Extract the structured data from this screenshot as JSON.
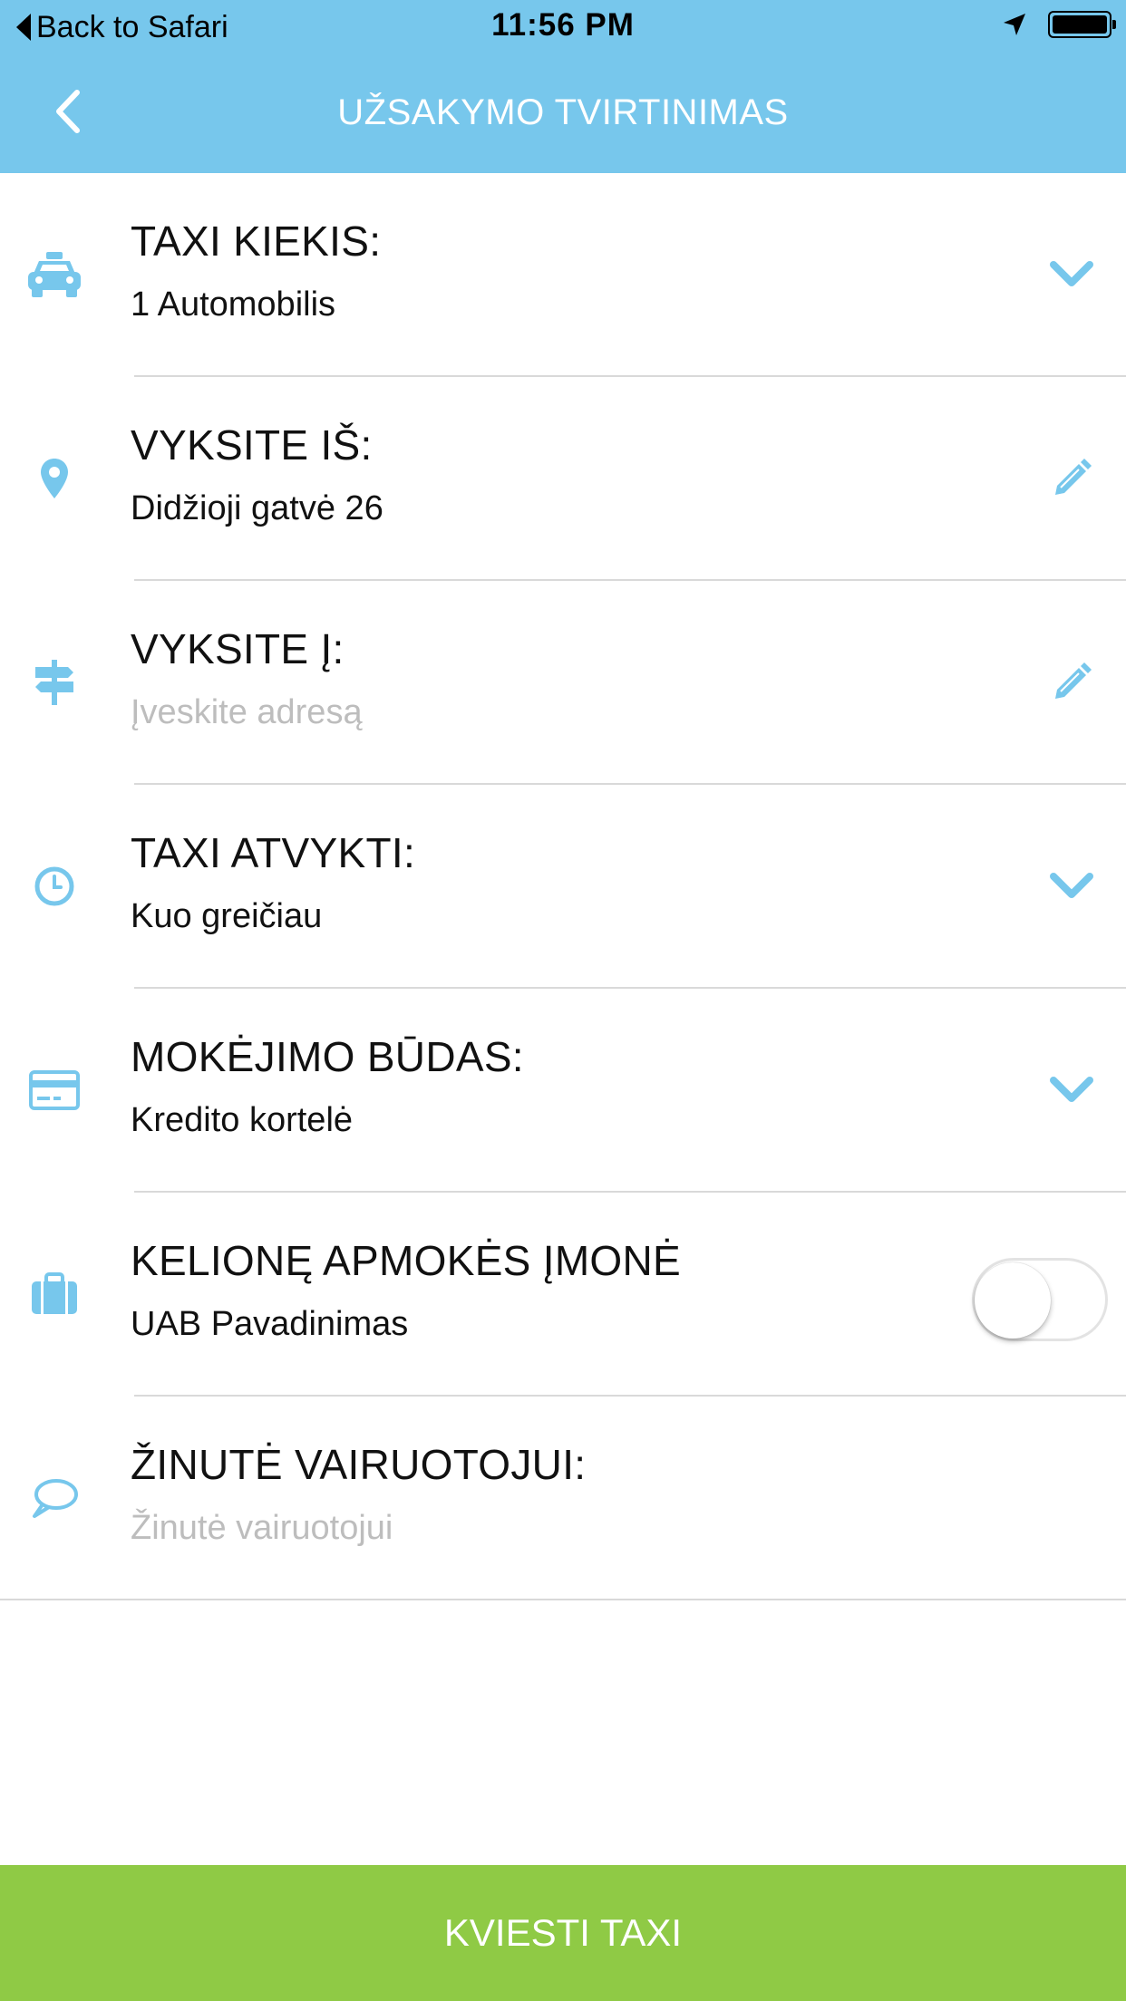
{
  "status_bar": {
    "back_label": "Back to Safari",
    "time": "11:56 PM",
    "icons": [
      "location-arrow-icon",
      "battery-icon"
    ]
  },
  "nav": {
    "title": "UŽSAKYMO TVIRTINIMAS",
    "back_icon": "chevron-left-icon"
  },
  "rows": [
    {
      "icon": "taxi-icon",
      "title": "TAXI KIEKIS:",
      "value": "1 Automobilis",
      "placeholder": false,
      "action": "chevron-down-icon"
    },
    {
      "icon": "map-pin-icon",
      "title": "VYKSITE IŠ:",
      "value": "Didžioji gatvė 26",
      "placeholder": false,
      "action": "pencil-icon"
    },
    {
      "icon": "signpost-icon",
      "title": "VYKSITE Į:",
      "value": "Įveskite adresą",
      "placeholder": true,
      "action": "pencil-icon"
    },
    {
      "icon": "clock-icon",
      "title": "TAXI ATVYKTI:",
      "value": "Kuo greičiau",
      "placeholder": false,
      "action": "chevron-down-icon"
    },
    {
      "icon": "credit-card-icon",
      "title": "MOKĖJIMO BŪDAS:",
      "value": "Kredito kortelė",
      "placeholder": false,
      "action": "chevron-down-icon"
    },
    {
      "icon": "briefcase-icon",
      "title": "KELIONĘ APMOKĖS ĮMONĖ",
      "value": "UAB Pavadinimas",
      "placeholder": false,
      "action": "toggle",
      "toggle_on": false
    },
    {
      "icon": "speech-bubble-icon",
      "title": "ŽINUTĖ VAIRUOTOJUI:",
      "value": "Žinutė vairuotojui",
      "placeholder": true,
      "action": "none"
    }
  ],
  "cta": {
    "label": "KVIESTI TAXI"
  },
  "colors": {
    "header": "#77c7ec",
    "accent": "#77c7ec",
    "cta": "#8fca45",
    "placeholder": "#bdbdbd",
    "divider": "#d9d9d9"
  }
}
